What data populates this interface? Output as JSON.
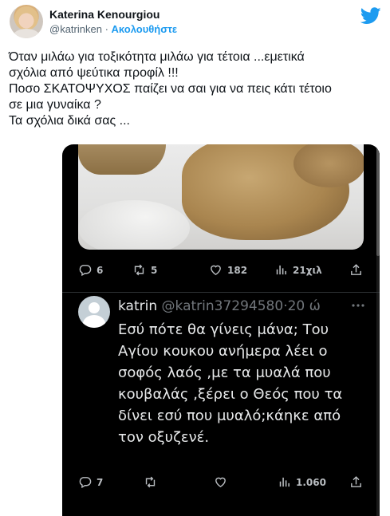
{
  "author": {
    "name": "Katerina Kenourgiou",
    "handle": "@katrinken",
    "separator": "·",
    "follow_label": "Ακολουθήστε"
  },
  "icons": {
    "brand": "twitter-bird-icon",
    "reply": "reply-icon",
    "retweet": "retweet-icon",
    "like": "heart-icon",
    "views": "analytics-icon",
    "share": "share-icon",
    "more": "more-dots-icon"
  },
  "colors": {
    "twitter_blue": "#1d9bf0",
    "dark_bg": "#000000",
    "dark_text": "#e7e9ea",
    "dark_muted": "#71767b"
  },
  "tweet": {
    "lines": [
      "Όταν μιλάω για τοξικότητα μιλάω για τέτοια ...εμετικά",
      "σχόλια από ψεύτικα προφίλ !!!",
      "Ποσο ΣΚΑΤΟΨΥΧΟΣ παίζει να σαι για να πεις κάτι τέτοιο",
      "σε μια γυναίκα ?",
      "Τα σχόλια δικά σας ..."
    ]
  },
  "screenshot": {
    "post_stats": {
      "replies": "6",
      "retweets": "5",
      "likes": "182",
      "views": "21χιλ"
    },
    "reply": {
      "name": "katrin",
      "handle": "@katrin37294580",
      "separator": "·",
      "time": "20 ώ",
      "lines": [
        "Εσύ πότε θα γίνεις μάνα; Του",
        "Αγίου κουκου ανήμερα λέει ο",
        "σοφός λαός  ,με τα μυαλά που",
        "κουβαλάς ,ξέρει ο Θεός που τα",
        "δίνει εσύ που μυαλό;κάηκε από",
        "τον οξυζενέ."
      ],
      "stats": {
        "replies": "7",
        "retweets": "",
        "likes": "",
        "views": "1.060"
      }
    }
  }
}
